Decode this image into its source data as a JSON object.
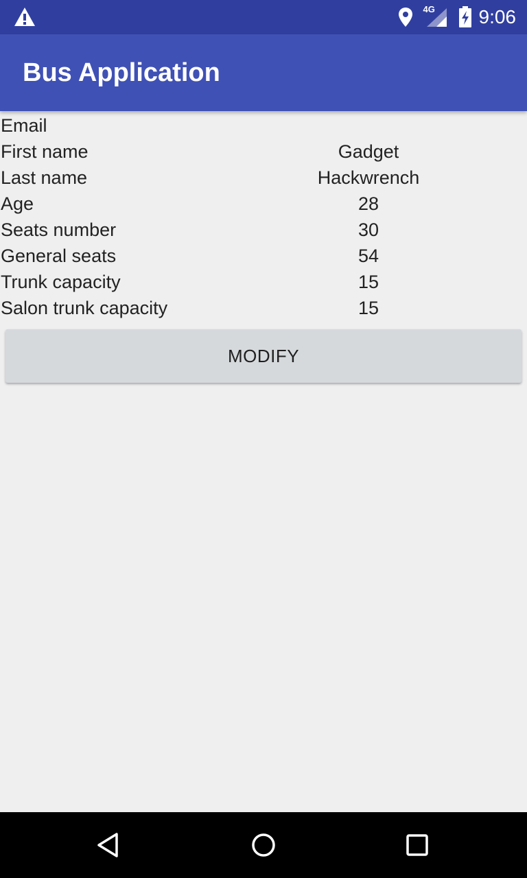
{
  "status_bar": {
    "network": "4G",
    "time": "9:06",
    "icons": [
      "warning-icon",
      "location-icon",
      "signal-icon",
      "battery-charging-icon"
    ]
  },
  "app_bar": {
    "title": "Bus Application"
  },
  "fields": [
    {
      "label": "Email",
      "value": ""
    },
    {
      "label": "First name",
      "value": "Gadget"
    },
    {
      "label": "Last name",
      "value": "Hackwrench"
    },
    {
      "label": "Age",
      "value": "28"
    },
    {
      "label": "Seats number",
      "value": "30"
    },
    {
      "label": "General seats",
      "value": "54"
    },
    {
      "label": "Trunk capacity",
      "value": "15"
    },
    {
      "label": "Salon trunk capacity",
      "value": "15"
    }
  ],
  "modify_button": {
    "label": "MODIFY"
  },
  "nav_bar": {
    "icons": [
      "back-icon",
      "home-icon",
      "recent-apps-icon"
    ]
  },
  "colors": {
    "status_bar": "#303f9f",
    "app_bar": "#3f51b5",
    "background": "#efefef",
    "button": "#d6d9dc",
    "nav_bar": "#000000"
  }
}
